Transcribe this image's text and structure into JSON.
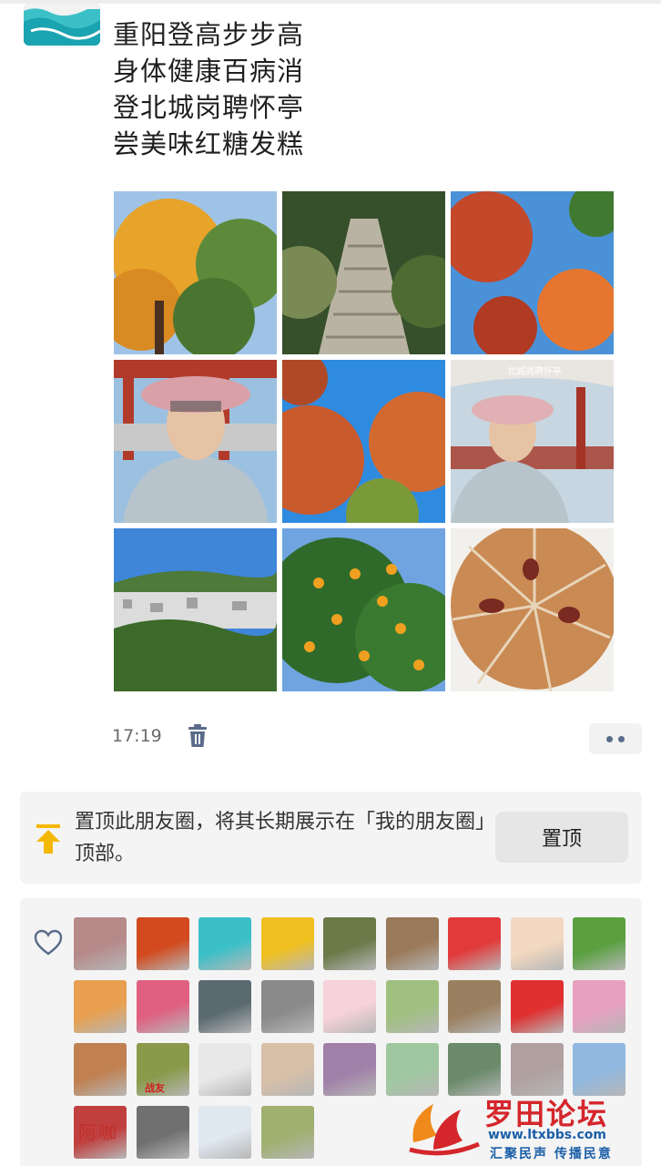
{
  "post": {
    "poem_lines": [
      "重阳登高步步高",
      "身体健康百病消",
      "登北城岗聘怀亭",
      "尝美味红糖发糕"
    ],
    "photos": [
      {
        "name": "autumn-tree-photo",
        "colors": [
          "#e8a32a",
          "#5d8a3a",
          "#9ec3e6"
        ]
      },
      {
        "name": "stone-stairs-photo",
        "colors": [
          "#7a8a55",
          "#b9b3a3",
          "#35502a"
        ]
      },
      {
        "name": "red-maple-photo",
        "colors": [
          "#c4482a",
          "#4b91d8",
          "#e6762f"
        ]
      },
      {
        "name": "selfie-pavilion-photo-1",
        "colors": [
          "#c9c9c9",
          "#d9a0a8",
          "#b23a2a"
        ]
      },
      {
        "name": "maple-canopy-photo",
        "colors": [
          "#c95a2c",
          "#2f8be0",
          "#7a9a3a"
        ]
      },
      {
        "name": "selfie-pavilion-photo-2",
        "colors": [
          "#c7c7c7",
          "#e0b0b5",
          "#a53426"
        ]
      },
      {
        "name": "town-view-photo",
        "colors": [
          "#3f86d9",
          "#4e7a3a",
          "#dcdcdc"
        ]
      },
      {
        "name": "orange-tree-photo",
        "colors": [
          "#2f6a2a",
          "#f0a020",
          "#6fa4e0"
        ]
      },
      {
        "name": "brown-sugar-cake-photo",
        "colors": [
          "#c98a54",
          "#f2f0ec",
          "#7a2a20"
        ]
      }
    ],
    "pavilion_sign": "北城岗聘怀亭",
    "time": "17:19"
  },
  "pin": {
    "text": "置顶此朋友圈，将其长期展示在「我的朋友圈」顶部。",
    "button_label": "置顶"
  },
  "likes": {
    "avatars": [
      "#b78a8a",
      "#d24a1e",
      "#3cc0c8",
      "#f0c020",
      "#6c7a4a",
      "#9a7a5a",
      "#e23a3a",
      "#f2d8c0",
      "#5aa040",
      "#e8a050",
      "#e06080",
      "#5a6a70",
      "#8a8a8a",
      "#f6d2da",
      "#a0c080",
      "#9a8060",
      "#e03030",
      "#e8a0c0",
      "#c08050",
      "#8a9a4a",
      "#e8e8e8",
      "#d8c0a8",
      "#a080a8",
      "#a0c8a0",
      "#6a8a6a",
      "#b0a0a0",
      "#90b8e0",
      "#c04040",
      "#707070",
      "#e0e8f0",
      "#a0b070"
    ],
    "avatar_badges": [
      "战友"
    ],
    "seal_text": "阿咖"
  },
  "watermark": {
    "title": "罗田论坛",
    "url": "www.ltxbbs.com",
    "slogan": "汇聚民声 传播民意"
  },
  "colors": {
    "accent_link": "#5a6b8a",
    "pin_icon": "#f5b800",
    "watermark_red": "#d4262b",
    "watermark_blue": "#1b5fa8"
  }
}
